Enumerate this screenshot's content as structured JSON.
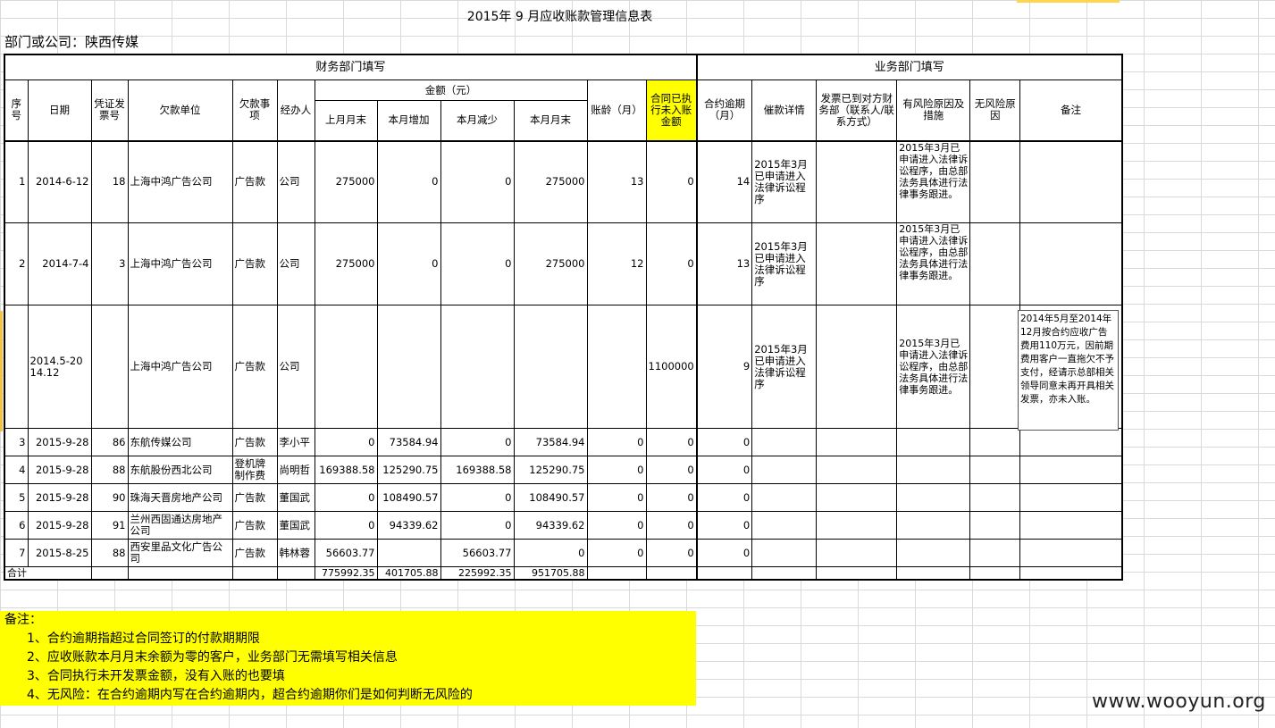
{
  "title": "2015年 9 月应收账款管理信息表",
  "department": "部门或公司：陕西传媒",
  "sections": {
    "finance": "财务部门填写",
    "business": "业务部门填写"
  },
  "headers": {
    "seq": "序号",
    "date": "日期",
    "voucher": "凭证发票号",
    "debtor": "欠款单位",
    "item": "欠款事项",
    "handler": "经办人",
    "amount_group": "金额（元）",
    "prev_month_end": "上月月末",
    "month_increase": "本月增加",
    "month_decrease": "本月减少",
    "month_end": "本月月末",
    "age": "账龄（月）",
    "contract_unbilled": "合同已执行未入账金额",
    "overdue": "合约逾期（月）",
    "collection": "催款详情",
    "invoice_delivered": "发票已到对方财务部（联系人/联系方式）",
    "risk_reason": "有风险原因及措施",
    "no_risk_reason": "无风险原因",
    "remark": "备注"
  },
  "rows": [
    {
      "seq": "1",
      "date": "2014-6-12",
      "voucher": "18",
      "debtor": "上海中鸿广告公司",
      "item": "广告款",
      "handler": "公司",
      "prev": "275000",
      "inc": "0",
      "dec": "0",
      "end": "275000",
      "age": "13",
      "unbilled": "0",
      "overdue": "14",
      "collection": "2015年3月已申请进入法律诉讼程序",
      "invoice": "",
      "risk": "2015年3月已申请进入法律诉讼程序，由总部法务具体进行法律事务跟进。",
      "norisk": "",
      "remark": ""
    },
    {
      "seq": "2",
      "date": "2014-7-4",
      "voucher": "3",
      "debtor": "上海中鸿广告公司",
      "item": "广告款",
      "handler": "公司",
      "prev": "275000",
      "inc": "0",
      "dec": "0",
      "end": "275000",
      "age": "12",
      "unbilled": "0",
      "overdue": "13",
      "collection": "2015年3月已申请进入法律诉讼程序",
      "invoice": "",
      "risk": "2015年3月已申请进入法律诉讼程序，由总部法务具体进行法律事务跟进。",
      "norisk": "",
      "remark": ""
    },
    {
      "seq": "",
      "date": "2014.5-2014.12",
      "voucher": "",
      "debtor": "上海中鸿广告公司",
      "item": "广告款",
      "handler": "公司",
      "prev": "",
      "inc": "",
      "dec": "",
      "end": "",
      "age": "",
      "unbilled": "1100000",
      "overdue": "9",
      "collection": "2015年3月已申请进入法律诉讼程序",
      "invoice": "",
      "risk": "2015年3月已申请进入法律诉讼程序，由总部法务具体进行法律事务跟进。",
      "norisk": "",
      "remark": "2014年5月至2014年12月按合约应收广告费用110万元，因前期费用客户一直拖欠不予支付，经请示总部相关领导同意未再开具相关发票，亦未入账。"
    },
    {
      "seq": "3",
      "date": "2015-9-28",
      "voucher": "86",
      "debtor": "东航传媒公司",
      "item": "广告款",
      "handler": "李小平",
      "prev": "0",
      "inc": "73584.94",
      "dec": "0",
      "end": "73584.94",
      "age": "0",
      "unbilled": "0",
      "overdue": "0",
      "collection": "",
      "invoice": "",
      "risk": "",
      "norisk": "",
      "remark": ""
    },
    {
      "seq": "4",
      "date": "2015-9-28",
      "voucher": "88",
      "debtor": "东航股份西北公司",
      "item": "登机牌制作费",
      "handler": "尚明哲",
      "prev": "169388.58",
      "inc": "125290.75",
      "dec": "169388.58",
      "end": "125290.75",
      "age": "0",
      "unbilled": "0",
      "overdue": "0",
      "collection": "",
      "invoice": "",
      "risk": "",
      "norisk": "",
      "remark": ""
    },
    {
      "seq": "5",
      "date": "2015-9-28",
      "voucher": "90",
      "debtor": "珠海天晋房地产公司",
      "item": "广告款",
      "handler": "董国武",
      "prev": "0",
      "inc": "108490.57",
      "dec": "0",
      "end": "108490.57",
      "age": "0",
      "unbilled": "0",
      "overdue": "0",
      "collection": "",
      "invoice": "",
      "risk": "",
      "norisk": "",
      "remark": ""
    },
    {
      "seq": "6",
      "date": "2015-9-28",
      "voucher": "91",
      "debtor": "兰州西固通达房地产公司",
      "item": "广告款",
      "handler": "董国武",
      "prev": "0",
      "inc": "94339.62",
      "dec": "0",
      "end": "94339.62",
      "age": "0",
      "unbilled": "0",
      "overdue": "0",
      "collection": "",
      "invoice": "",
      "risk": "",
      "norisk": "",
      "remark": ""
    },
    {
      "seq": "7",
      "date": "2015-8-25",
      "voucher": "88",
      "debtor": "西安里品文化广告公司",
      "item": "广告款",
      "handler": "韩林蓉",
      "prev": "56603.77",
      "inc": "",
      "dec": "56603.77",
      "end": "0",
      "age": "0",
      "unbilled": "0",
      "overdue": "0",
      "collection": "",
      "invoice": "",
      "risk": "",
      "norisk": "",
      "remark": ""
    }
  ],
  "total": {
    "label": "合计",
    "prev": "775992.35",
    "inc": "401705.88",
    "dec": "225992.35",
    "end": "951705.88"
  },
  "notes": {
    "head": "备注：",
    "items": [
      "1、合约逾期指超过合同签订的付款期期限",
      "2、应收账款本月月末余额为零的客户，业务部门无需填写相关信息",
      "3、合同执行未开发票金额，没有入账的也要填",
      "4、无风险：在合约逾期内写在合约逾期内，超合约逾期你们是如何判断无风险的"
    ]
  },
  "watermark": "www.wooyun.org",
  "colors": {
    "highlight": "#ffff00",
    "accent_orange": "#f5c242"
  }
}
